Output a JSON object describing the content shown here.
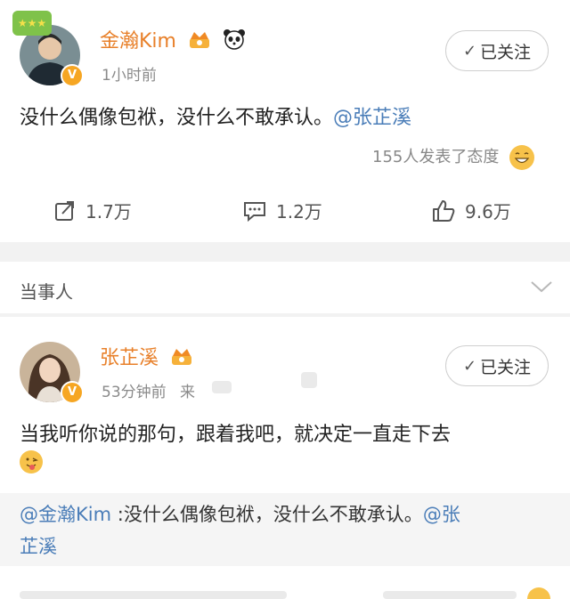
{
  "post1": {
    "username": "金瀚Kim",
    "time": "1小时前",
    "follow_label": "已关注",
    "text_main": "没什么偶像包袱，没什么不敢承认。",
    "text_mention": "@张芷溪",
    "reactions": "155人发表了态度",
    "actions": {
      "repost": "1.7万",
      "comment": "1.2万",
      "like": "9.6万"
    }
  },
  "section": {
    "title": "当事人"
  },
  "post2": {
    "username": "张芷溪",
    "time": "53分钟前",
    "source_prefix": "来",
    "follow_label": "已关注",
    "text_main": "当我听你说的那句，跟着我吧，就决定一直走下去",
    "quote_mention": "@金瀚Kim",
    "quote_text": " :没什么偶像包袱，没什么不敢承认。",
    "quote_mention2_a": "@张",
    "quote_mention2_b": "芷溪"
  },
  "icons": {
    "repost": "repost-icon",
    "comment": "comment-icon",
    "like": "like-icon",
    "chevron": "chevron-down-icon"
  },
  "colors": {
    "username": "#e8802a",
    "mention": "#4a7db8",
    "badge": "#f6a623"
  }
}
